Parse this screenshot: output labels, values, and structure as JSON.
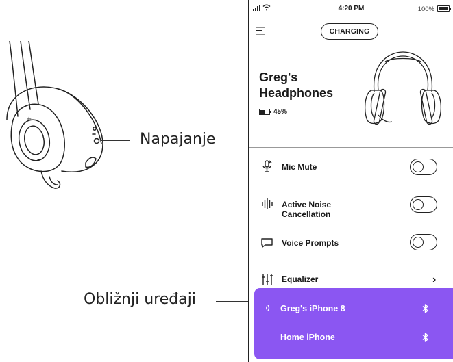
{
  "callouts": {
    "power": "Napajanje",
    "nearby_devices": "Obližnji uređaji"
  },
  "status_bar": {
    "time": "4:20 PM",
    "battery": "100%"
  },
  "header": {
    "charging_label": "CHARGING"
  },
  "device": {
    "name_line1": "Greg's",
    "name_line2": "Headphones",
    "battery_level": "45%"
  },
  "settings": {
    "mic_mute": "Mic Mute",
    "anc_line1": "Active Noise",
    "anc_line2": "Cancellation",
    "voice_prompts": "Voice Prompts",
    "equalizer": "Equalizer"
  },
  "nearby": {
    "device1": "Greg's iPhone 8",
    "device2": "Home iPhone"
  },
  "colors": {
    "accent": "#8b56f2"
  }
}
